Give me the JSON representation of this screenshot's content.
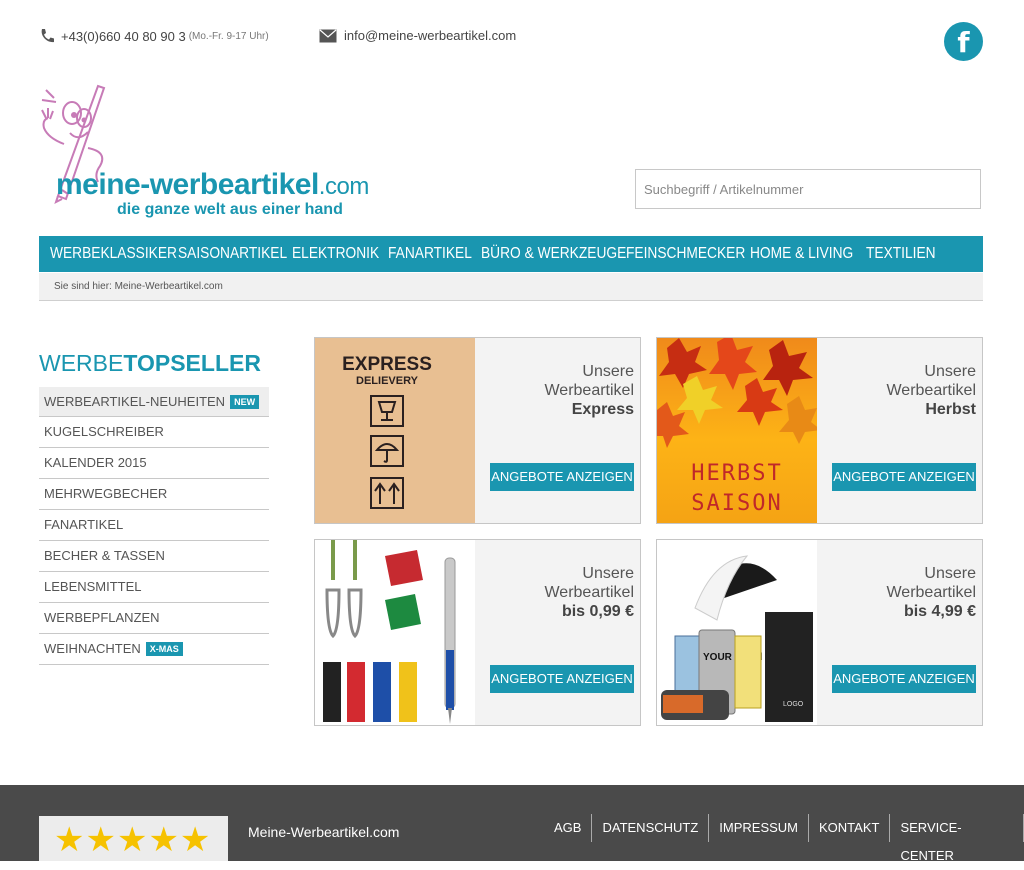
{
  "header": {
    "phone": "+43(0)660 40 80 90 3",
    "phone_hours": "(Mo.-Fr. 9-17 Uhr)",
    "email": "info@meine-werbeartikel.com",
    "facebook_glyph": "f"
  },
  "logo": {
    "title": "meine-werbeartikel",
    "title_suffix": ".com",
    "tagline": "die ganze welt aus einer hand"
  },
  "search": {
    "placeholder": "Suchbegriff / Artikelnummer"
  },
  "nav": {
    "items": [
      "WERBEKLASSIKER",
      "SAISONARTIKEL",
      "ELEKTRONIK",
      "FANARTIKEL",
      "BÜRO & WERKZEUGE",
      "FEINSCHMECKER",
      "HOME & LIVING",
      "TEXTILIEN"
    ]
  },
  "breadcrumb": {
    "text": "Sie sind hier: Meine-Werbeartikel.com"
  },
  "sidebar": {
    "title_part1": "WERBE",
    "title_part2": "TOPSELLER",
    "items": [
      {
        "label": "WERBEARTIKEL-NEUHEITEN",
        "badge": "NEW"
      },
      {
        "label": "KUGELSCHREIBER"
      },
      {
        "label": "KALENDER 2015"
      },
      {
        "label": "MEHRWEGBECHER"
      },
      {
        "label": "FANARTIKEL"
      },
      {
        "label": "BECHER & TASSEN"
      },
      {
        "label": "LEBENSMITTEL"
      },
      {
        "label": "WERBEPFLANZEN"
      },
      {
        "label": "WEIHNACHTEN",
        "badge": "X-MAS"
      }
    ]
  },
  "promos": [
    {
      "line1": "Unsere",
      "line2": "Werbeartikel",
      "highlight": "Express",
      "button": "ANGEBOTE ANZEIGEN",
      "img_title": "EXPRESS",
      "img_sub": "DELIEVERY"
    },
    {
      "line1": "Unsere",
      "line2": "Werbeartikel",
      "highlight": "Herbst",
      "button": "ANGEBOTE ANZEIGEN",
      "img_title": "HERBST",
      "img_sub": "SAISON"
    },
    {
      "line1": "Unsere",
      "line2": "Werbeartikel",
      "highlight": "bis 0,99 €",
      "button": "ANGEBOTE ANZEIGEN"
    },
    {
      "line1": "Unsere",
      "line2": "Werbeartikel",
      "highlight": "bis 4,99 €",
      "button": "ANGEBOTE ANZEIGEN",
      "img_title": "YOUR brand",
      "img_sub": "LOGO"
    }
  ],
  "footer": {
    "rating_stars": 5,
    "stars_glyphs": "★★★★★",
    "brand": "Meine-Werbeartikel.com",
    "links": [
      "AGB",
      "DATENSCHUTZ",
      "IMPRESSUM",
      "KONTAKT",
      "SERVICE-CENTER"
    ]
  },
  "colors": {
    "accent": "#1a96b0",
    "footer_bg": "#4a4a4a",
    "star": "#f6c200"
  }
}
